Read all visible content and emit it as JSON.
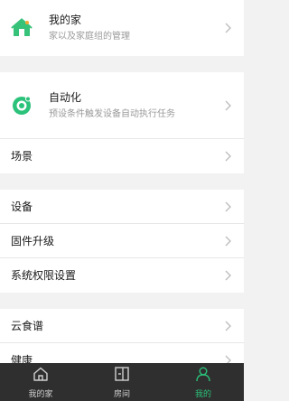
{
  "colors": {
    "accent": "#2bc27a",
    "tabbar_bg": "#2f2f2f",
    "tab_inactive": "#d0d0d0",
    "background": "#f2f2f2"
  },
  "my_home": {
    "title": "我的家",
    "subtitle": "家以及家庭组的管理",
    "icon": "house-icon"
  },
  "automation": {
    "title": "自动化",
    "subtitle": "预设条件触发设备自动执行任务",
    "icon": "automation-icon"
  },
  "scene": {
    "title": "场景"
  },
  "devices": {
    "title": "设备"
  },
  "firmware": {
    "title": "固件升级"
  },
  "permissions": {
    "title": "系统权限设置"
  },
  "recipes": {
    "title": "云食谱"
  },
  "health": {
    "title": "健康"
  },
  "tabs": [
    {
      "label": "我的家",
      "icon": "home-icon",
      "active": false
    },
    {
      "label": "房间",
      "icon": "room-icon",
      "active": false
    },
    {
      "label": "我的",
      "icon": "profile-icon",
      "active": true
    }
  ]
}
